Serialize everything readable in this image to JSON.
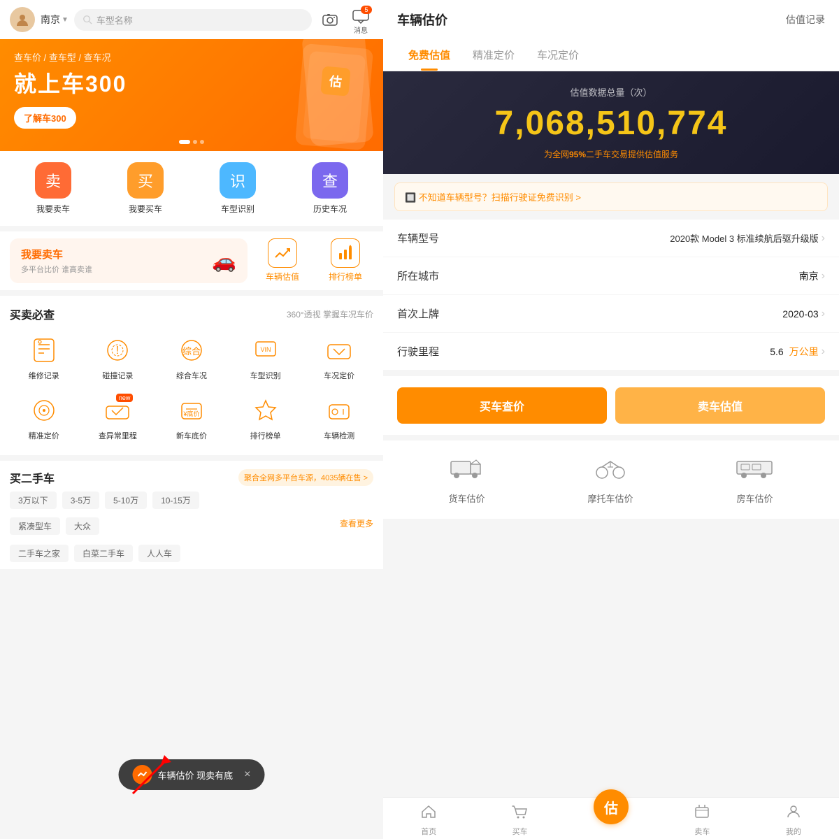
{
  "left": {
    "header": {
      "avatar_label": "我的",
      "city": "南京",
      "search_placeholder": "车型名称",
      "msg_label": "消息",
      "msg_badge": "5"
    },
    "banner": {
      "text1": "查车价 / 查车型 / 查车况",
      "title": "就上车300",
      "btn": "了解车300"
    },
    "quick_actions": [
      {
        "label": "我要卖车",
        "icon": "卖"
      },
      {
        "label": "我要买车",
        "icon": "买"
      },
      {
        "label": "车型识别",
        "icon": "识"
      },
      {
        "label": "历史车况",
        "icon": "查"
      }
    ],
    "mid_tools": [
      {
        "label": "车辆估值",
        "icon": "📊"
      },
      {
        "label": "排行榜单",
        "icon": "🏆"
      }
    ],
    "sell_card": {
      "title": "我要卖车",
      "sub": "多平台比价 谁高卖谁"
    },
    "check_section": {
      "title": "买卖必查",
      "sub": "360°透视 掌握车况车价"
    },
    "grid_items": [
      {
        "label": "维修记录"
      },
      {
        "label": "碰撞记录"
      },
      {
        "label": "综合车况"
      },
      {
        "label": "车型识别"
      },
      {
        "label": "车况定价"
      },
      {
        "label": "精准定价"
      },
      {
        "label": "查异常里程"
      },
      {
        "label": "新车底价"
      },
      {
        "label": "排行榜单"
      },
      {
        "label": "车辆检测"
      }
    ],
    "used_cars": {
      "title": "买二手车",
      "badge": "聚合全网多平台车源，4035辆在售 >"
    },
    "price_ranges": [
      "3万以下",
      "3-5万",
      "5-10万",
      "10-15万"
    ],
    "car_types": [
      "紧凑型车",
      "大众"
    ],
    "more_label": "查看更多",
    "second_rows": [
      "二手车之家",
      "白菜二手车",
      "人人车"
    ],
    "toast": {
      "text": "车辆估价 现卖有底",
      "close": "×"
    }
  },
  "right": {
    "header": {
      "title": "车辆估价",
      "history": "估值记录"
    },
    "tabs": [
      {
        "label": "免费估值",
        "active": true
      },
      {
        "label": "精准定价",
        "active": false
      },
      {
        "label": "车况定价",
        "active": false
      }
    ],
    "stats": {
      "label": "估值数据总量（次）",
      "number": "7,068,510,774",
      "sub_prefix": "为全网",
      "sub_highlight": "95%",
      "sub_suffix": "二手车交易提供估值服务"
    },
    "scan_hint": "🔲 不知道车辆型号？扫描行驶证免费识别 >",
    "fields": [
      {
        "label": "车辆型号",
        "value": "2020款 Model 3 标准续航后驱升级版",
        "arrow": true
      },
      {
        "label": "所在城市",
        "value": "南京",
        "arrow": true
      },
      {
        "label": "首次上牌",
        "value": "2020-03",
        "arrow": true
      },
      {
        "label": "行驶里程",
        "value": "5.6",
        "unit": "万公里",
        "arrow": true
      }
    ],
    "buttons": {
      "query": "买车查价",
      "sell": "卖车估值"
    },
    "vehicle_types": [
      {
        "label": "货车估价",
        "icon": "🚛"
      },
      {
        "label": "摩托车估价",
        "icon": "🏍️"
      },
      {
        "label": "房车估价",
        "icon": "🚐"
      }
    ],
    "bottom_nav": [
      {
        "label": "首页",
        "icon": "🏠",
        "active": false
      },
      {
        "label": "买车",
        "icon": "🚗",
        "active": false
      },
      {
        "label": "估",
        "icon": "估",
        "active": true
      },
      {
        "label": "卖车",
        "icon": "🏷️",
        "active": false
      },
      {
        "label": "我的",
        "icon": "👤",
        "active": false
      }
    ]
  }
}
